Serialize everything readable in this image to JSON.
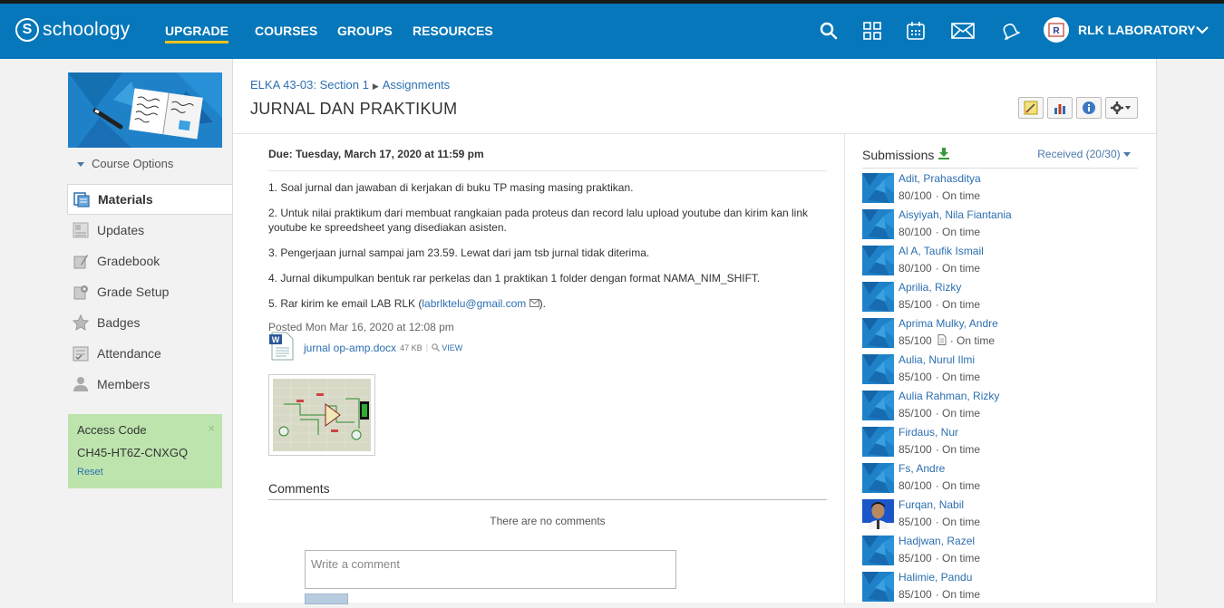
{
  "topbar": {
    "logo_text": "schoology",
    "nav": [
      "UPGRADE",
      "COURSES",
      "GROUPS",
      "RESOURCES"
    ],
    "user_name": "RLK LABORATORY",
    "brand_color": "#0677ba",
    "icons": [
      "search-icon",
      "apps-grid-icon",
      "calendar-icon",
      "mail-icon",
      "bell-icon",
      "chevron-down-icon"
    ]
  },
  "sidebar": {
    "course_options": "Course Options",
    "items": [
      {
        "label": "Materials",
        "icon": "materials-icon",
        "active": true
      },
      {
        "label": "Updates",
        "icon": "updates-icon",
        "active": false
      },
      {
        "label": "Gradebook",
        "icon": "gradebook-icon",
        "active": false
      },
      {
        "label": "Grade Setup",
        "icon": "grade-setup-icon",
        "active": false
      },
      {
        "label": "Badges",
        "icon": "badge-icon",
        "active": false
      },
      {
        "label": "Attendance",
        "icon": "attendance-icon",
        "active": false
      },
      {
        "label": "Members",
        "icon": "members-icon",
        "active": false
      }
    ],
    "access": {
      "heading": "Access Code",
      "code": "CH45-HT6Z-CNXGQ",
      "reset": "Reset",
      "close": "×"
    }
  },
  "main": {
    "breadcrumb": {
      "course": "ELKA 43-03: Section 1",
      "section": "Assignments"
    },
    "title": "JURNAL DAN PRAKTIKUM",
    "due": "Due: Tuesday, March 17, 2020 at 11:59 pm",
    "paragraphs": [
      "1. Soal jurnal dan jawaban di kerjakan di buku TP masing masing praktikan.",
      "2. Untuk nilai praktikum dari membuat rangkaian pada proteus dan record lalu upload youtube dan kirim kan link youtube ke spreedsheet yang disediakan asisten.",
      "3. Pengerjaan jurnal sampai jam 23.59. Lewat dari jam tsb jurnal tidak diterima.",
      "4. Jurnal dikumpulkan bentuk rar perkelas dan 1 praktikan 1 folder dengan format NAMA_NIM_SHIFT."
    ],
    "p5_prefix": "5. Rar kirim ke email LAB RLK (",
    "p5_email": "labrlktelu@gmail.com",
    "p5_suffix": ").",
    "posted": "Posted Mon Mar 16, 2020 at 12:08 pm",
    "attachment": {
      "name": "jurnal op-amp.docx",
      "size": "47 KB",
      "view": "VIEW"
    },
    "comments": {
      "heading": "Comments",
      "empty": "There are no comments",
      "placeholder": "Write a comment"
    }
  },
  "submissions": {
    "heading": "Submissions",
    "received": "Received (20/30)",
    "rows": [
      {
        "name": "Adit, Prahasditya",
        "grade": "80/100",
        "status": "· On time",
        "doc": false,
        "photo": false
      },
      {
        "name": "Aisyiyah, Nila Fiantania",
        "grade": "80/100",
        "status": "· On time",
        "doc": false,
        "photo": false
      },
      {
        "name": "Al A, Taufik Ismail",
        "grade": "80/100",
        "status": "· On time",
        "doc": false,
        "photo": false
      },
      {
        "name": "Aprilia, Rizky",
        "grade": "85/100",
        "status": "· On time",
        "doc": false,
        "photo": false
      },
      {
        "name": "Aprima Mulky, Andre",
        "grade": "85/100",
        "status": "· On time",
        "doc": true,
        "photo": false
      },
      {
        "name": "Aulia, Nurul Ilmi",
        "grade": "85/100",
        "status": "· On time",
        "doc": false,
        "photo": false
      },
      {
        "name": "Aulia Rahman, Rizky",
        "grade": "85/100",
        "status": "· On time",
        "doc": false,
        "photo": false
      },
      {
        "name": "Firdaus, Nur",
        "grade": "85/100",
        "status": "· On time",
        "doc": false,
        "photo": false
      },
      {
        "name": "Fs, Andre",
        "grade": "80/100",
        "status": "· On time",
        "doc": false,
        "photo": false
      },
      {
        "name": "Furqan, Nabil",
        "grade": "85/100",
        "status": "· On time",
        "doc": false,
        "photo": true
      },
      {
        "name": "Hadjwan, Razel",
        "grade": "85/100",
        "status": "· On time",
        "doc": false,
        "photo": false
      },
      {
        "name": "Halimie, Pandu",
        "grade": "85/100",
        "status": "· On time",
        "doc": false,
        "photo": false
      }
    ]
  }
}
